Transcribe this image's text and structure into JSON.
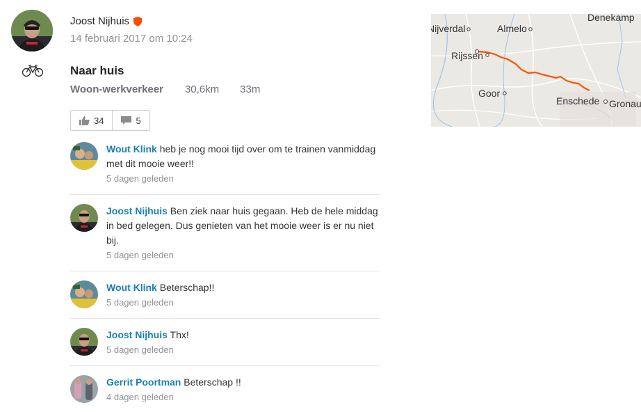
{
  "athlete": {
    "name": "Joost Nijhuis",
    "badge_icon": "shield-icon",
    "badge_color": "#fc4c02"
  },
  "activity": {
    "date": "14 februari 2017 om 10:24",
    "type_icon": "bike-icon",
    "title": "Naar huis",
    "commute_label": "Woon-werkverkeer",
    "distance": "30,6km",
    "duration": "33m"
  },
  "social": {
    "kudos_count": "34",
    "comments_count": "5"
  },
  "comments": [
    {
      "author": "Wout Klink",
      "text": " heb je nog mooi tijd over om te trainen vanmiddag met dit mooie weer!!",
      "time": "5 dagen geleden"
    },
    {
      "author": "Joost Nijhuis",
      "text": " Ben ziek naar huis gegaan. Heb de hele middag in bed gelegen. Dus genieten van het mooie weer is er nu niet bij.",
      "time": "5 dagen geleden"
    },
    {
      "author": "Wout Klink",
      "text": " Beterschap!!",
      "time": "5 dagen geleden"
    },
    {
      "author": "Joost Nijhuis",
      "text": " Thx!",
      "time": "5 dagen geleden"
    },
    {
      "author": "Gerrit Poortman",
      "text": " Beterschap !!",
      "time": "4 dagen geleden"
    }
  ],
  "map": {
    "labels": [
      "Denekamp",
      "Nijverdal",
      "Almelo",
      "Rijssen",
      "Goor",
      "Enschede",
      "Gronau"
    ],
    "route_color": "#fc5200"
  },
  "colors": {
    "link": "#1a7fb5",
    "muted": "#929296",
    "brand": "#fc4c02"
  }
}
